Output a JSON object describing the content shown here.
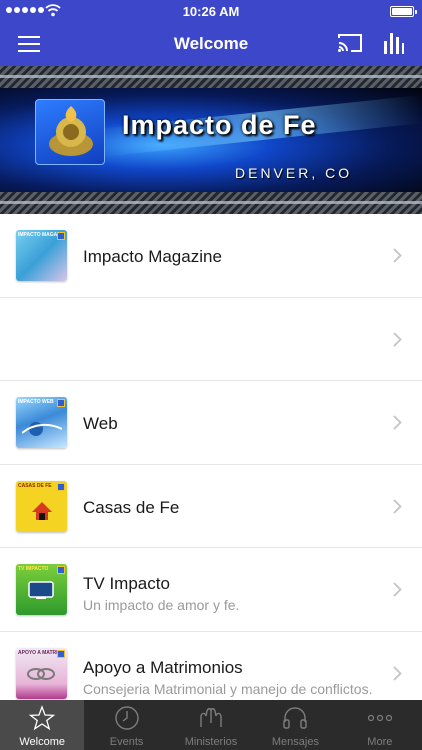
{
  "status_bar": {
    "time": "10:26 AM"
  },
  "nav": {
    "title": "Welcome"
  },
  "banner": {
    "title": "Impacto de Fe",
    "city": "Denver, CO"
  },
  "list": [
    {
      "title": "Impacto Magazine",
      "subtitle": "",
      "thumb_text": "IMPACTO MAGAZINE"
    },
    {
      "title": "",
      "subtitle": ""
    },
    {
      "title": "Web",
      "subtitle": "",
      "thumb_text": "IMPACTO WEB"
    },
    {
      "title": "Casas de Fe",
      "subtitle": "",
      "thumb_text": "CASAS DE FE"
    },
    {
      "title": "TV Impacto",
      "subtitle": "Un impacto de amor y fe.",
      "thumb_text": "TV IMPACTO"
    },
    {
      "title": "Apoyo a Matrimonios",
      "subtitle": "Consejeria Matrimonial y manejo de conflictos.",
      "thumb_text": "APOYO A MATRIMONIOS"
    }
  ],
  "tabs": [
    {
      "label": "Welcome",
      "icon": "star-icon"
    },
    {
      "label": "Events",
      "icon": "clock-icon"
    },
    {
      "label": "Ministerios",
      "icon": "hands-icon"
    },
    {
      "label": "Mensajes",
      "icon": "headphones-icon"
    },
    {
      "label": "More",
      "icon": "more-dots-icon"
    }
  ],
  "colors": {
    "nav": "#3d47c9",
    "tabbar": "#2b2b2b",
    "tab_active": "#4a4a4a"
  }
}
